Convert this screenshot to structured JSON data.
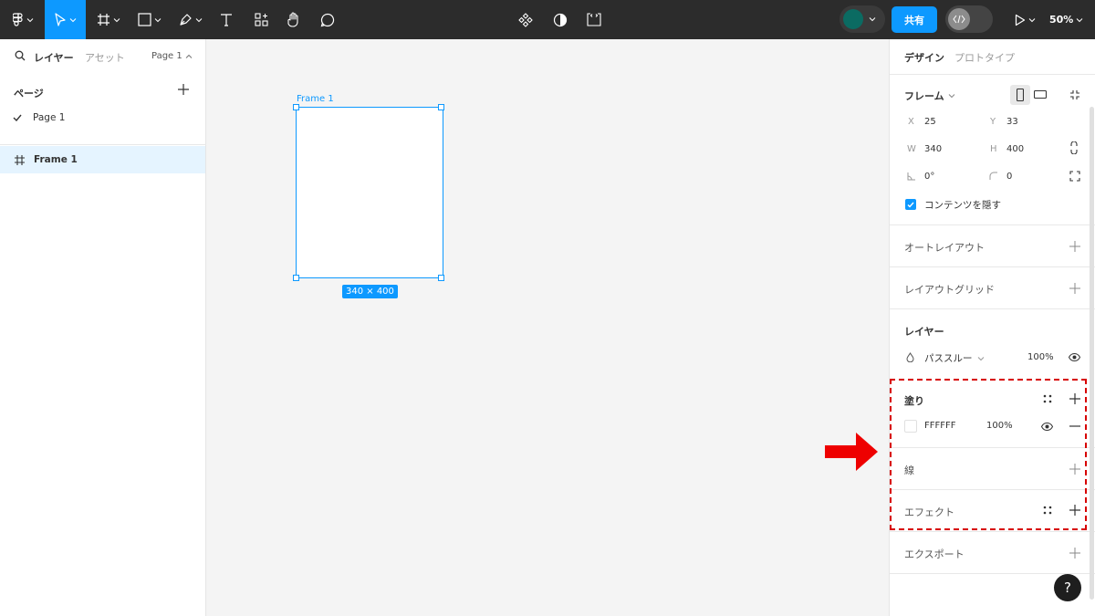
{
  "toolbar": {
    "tools": [
      {
        "name": "main-menu",
        "icon": "figma-logo-icon"
      },
      {
        "name": "move",
        "icon": "cursor-icon"
      },
      {
        "name": "frame",
        "icon": "frame-hash-icon"
      },
      {
        "name": "shape",
        "icon": "rectangle-icon"
      },
      {
        "name": "pen",
        "icon": "pen-icon"
      },
      {
        "name": "text",
        "icon": "text-icon"
      },
      {
        "name": "resources",
        "icon": "resources-icon"
      },
      {
        "name": "hand",
        "icon": "hand-icon"
      },
      {
        "name": "comment",
        "icon": "comment-icon"
      }
    ],
    "center_tools": [
      "component-icon",
      "mask-icon",
      "dev-code-icon"
    ],
    "share_label": "共有",
    "zoom": "50%"
  },
  "left_panel": {
    "tab_layers": "レイヤー",
    "tab_assets": "アセット",
    "page_select": "Page 1",
    "pages_title": "ページ",
    "pages": [
      "Page 1"
    ],
    "layers": [
      "Frame 1"
    ]
  },
  "canvas": {
    "frame_label": "Frame 1",
    "dimensions": "340 × 400"
  },
  "right_panel": {
    "tab_design": "デザイン",
    "tab_prototype": "プロトタイプ",
    "frame": {
      "title": "フレーム",
      "x_label": "X",
      "x": "25",
      "y_label": "Y",
      "y": "33",
      "w_label": "W",
      "w": "340",
      "h_label": "H",
      "h": "400",
      "rotation": "0°",
      "radius": "0",
      "clip_label": "コンテンツを隠す"
    },
    "auto_layout": "オートレイアウト",
    "layout_grid": "レイアウトグリッド",
    "layer": {
      "title": "レイヤー",
      "blend": "パススルー",
      "opacity": "100%"
    },
    "fill": {
      "title": "塗り",
      "hex": "FFFFFF",
      "opacity": "100%"
    },
    "stroke": "線",
    "effects": "エフェクト",
    "export": "エクスポート",
    "help": "?"
  },
  "colors": {
    "accent": "#0d99ff",
    "toolbar_bg": "#2c2c2c",
    "highlight": "#d70000",
    "arrow": "#ee0000"
  }
}
